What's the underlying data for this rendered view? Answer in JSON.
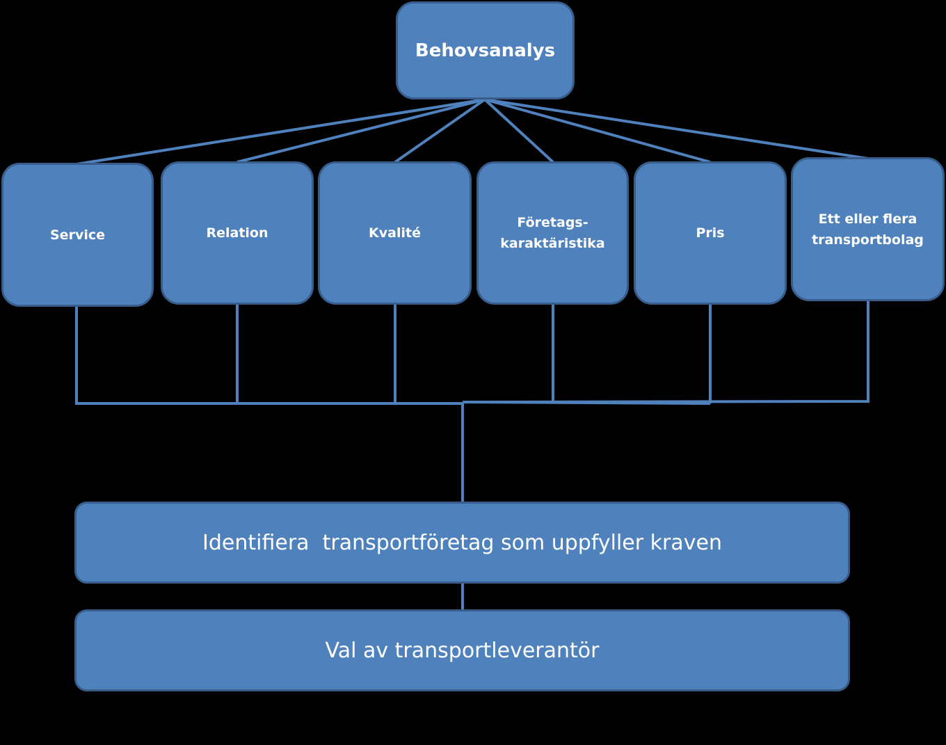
{
  "colors": {
    "fill": "#4f81bd",
    "stroke": "#385d8a",
    "background": "#000000"
  },
  "root": {
    "label": "Behovsanalys"
  },
  "criteria": [
    {
      "label": "Service"
    },
    {
      "label": "Relation"
    },
    {
      "label": "Kvalité"
    },
    {
      "label": "Företags-\nkaraktäristika"
    },
    {
      "label": "Pris"
    },
    {
      "label": "Ett eller flera transportbolag"
    }
  ],
  "steps": [
    {
      "label": "Identifiera  transportföretag som uppfyller kraven"
    },
    {
      "label": "Val av transportleverantör"
    }
  ]
}
